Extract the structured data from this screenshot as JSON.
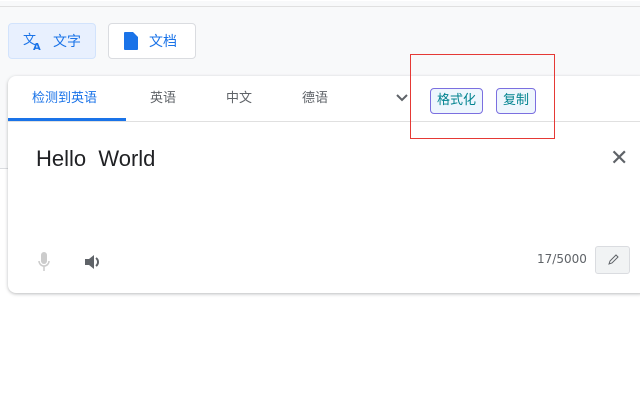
{
  "modes": [
    {
      "label": "文字",
      "icon": "translate-icon"
    },
    {
      "label": "文档",
      "icon": "document-icon"
    }
  ],
  "tabs": [
    "检测到英语",
    "英语",
    "中文",
    "德语"
  ],
  "actions": {
    "format": "格式化",
    "copy": "复制"
  },
  "input": {
    "value": "Hello  World",
    "char_count": "17/5000"
  },
  "colors": {
    "accent": "#1a73e8",
    "highlight": "#e53935"
  }
}
